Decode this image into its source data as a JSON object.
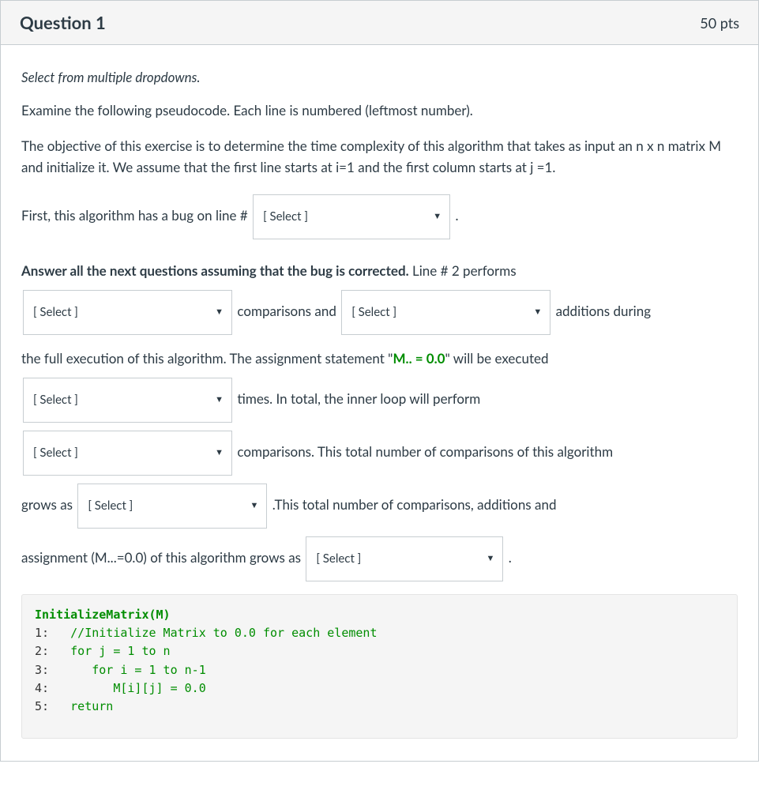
{
  "header": {
    "title": "Question 1",
    "points": "50 pts"
  },
  "body": {
    "instruction": "Select from multiple dropdowns.",
    "p1": "Examine the following pseudocode. Each line is numbered (leftmost number).",
    "p2": "The objective of this exercise is to determine the time complexity of this algorithm that takes as input an n x n matrix M  and initialize it. We assume that the first line starts at i=1 and the first column starts at j =1.",
    "t_first": "First, this algorithm has a bug on line #",
    "t_period": ".",
    "t_answer_all_pre": "Answer all the next questions assuming that the bug is corrected.",
    "t_line2_performs": " Line # 2 performs",
    "t_comparisons_and": "comparisons and",
    "t_additions_during": "additions during",
    "t_full_exec_pre": "the full execution of this algorithm. The assignment statement \"",
    "t_m_assign": "M.. = 0.0",
    "t_full_exec_post": "\" will be executed",
    "t_times_inner": "times. In total, the inner loop will perform",
    "t_comparisons_total": "comparisons. This total number of comparisons of this algorithm",
    "t_grows_as": "grows as",
    "t_this_total": ".This total number of comparisons, additions and",
    "t_assignment_grows": "assignment (M...=0.0) of this algorithm grows as",
    "select_placeholder": "[ Select ]"
  },
  "code": {
    "fn": "InitializeMatrix(M)",
    "l1_num": "1:",
    "l1_txt": "//Initialize Matrix to 0.0 for each element",
    "l2_num": "2:",
    "l2_txt": "for j = 1 to n",
    "l3_num": "3:",
    "l3_txt": "for i = 1 to n-1",
    "l4_num": "4:",
    "l4_txt": "M[i][j] = 0.0",
    "l5_num": "5:",
    "l5_txt": "return"
  }
}
